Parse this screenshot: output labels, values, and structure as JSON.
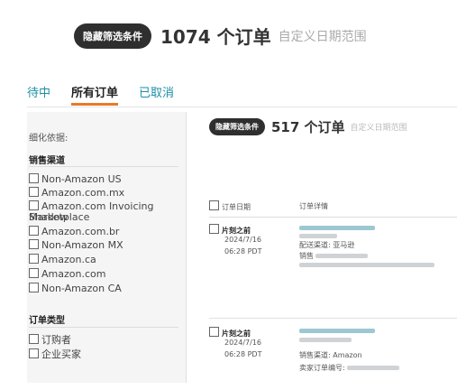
{
  "top": {
    "hide_filters": "隐藏筛选条件",
    "order_count": "1074 个订单",
    "date_range": "自定义日期范围"
  },
  "tabs": [
    {
      "label": "待中"
    },
    {
      "label": "所有订单"
    },
    {
      "label": "已取消"
    }
  ],
  "sidebar": {
    "refine_label": "细化依据:",
    "channel_title": "销售渠道",
    "channels": [
      "Non-Amazon US",
      "Amazon.com.mx",
      "Amazon.com Invoicing Shadow",
      "Amazon.com.br",
      "Non-Amazon MX",
      "Amazon.ca",
      "Amazon.com",
      "Non-Amazon CA"
    ],
    "channel_wrap": "Marketplace",
    "order_type_title": "订单类型",
    "order_types": [
      "订购者",
      "企业买家"
    ]
  },
  "inner": {
    "hide_filters": "隐藏筛选条件",
    "order_count": "517 个订单",
    "date_range": "自定义日期范围"
  },
  "table": {
    "col_date": "订单日期",
    "col_detail": "订单详情",
    "rows": [
      {
        "title": "片刻之前",
        "date": "2024/7/16",
        "time": "06:28 PDT",
        "channel": "配送渠道: 亚马逊",
        "seller_label": "销售"
      },
      {
        "title": "片刻之前",
        "date": "2024/7/16",
        "time": "06:28 PDT",
        "channel": "销售渠道: Amazon",
        "seller_label": "卖家订单编号:"
      }
    ]
  },
  "colors": {
    "accent": "#e8792a",
    "link": "#1d8ea6",
    "pill": "#2f2f2f"
  }
}
